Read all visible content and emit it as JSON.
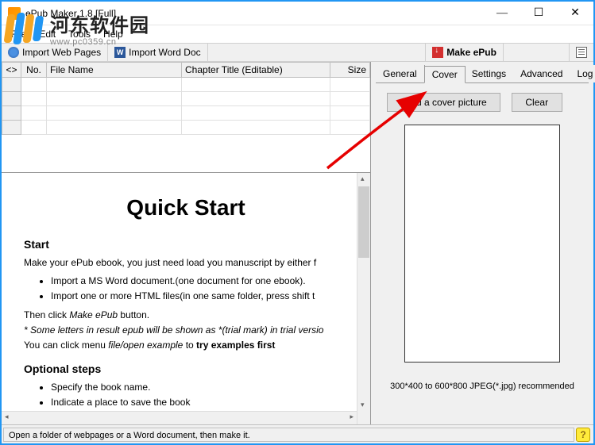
{
  "window": {
    "title": "ePub Maker 1.8 [Full]"
  },
  "menu": {
    "file": "File",
    "edit": "Edit",
    "tools": "Tools",
    "help": "Help"
  },
  "watermark": {
    "site_cn": "河东软件园",
    "site_url": "www.pc0359.cn"
  },
  "toolbar": {
    "import_web": "Import Web Pages",
    "import_word": "Import Word Doc",
    "make_epub": "Make ePub"
  },
  "table": {
    "headers": {
      "gutter": "<>",
      "no": "No.",
      "filename": "File Name",
      "chapter": "Chapter Title (Editable)",
      "size": "Size"
    }
  },
  "preview": {
    "title": "Quick Start",
    "h_start": "Start",
    "p1": "Make your ePub ebook, you just need load you manuscript by either f",
    "li1a": "Import a MS Word document.(one document for one ebook).",
    "li1b": "Import one or more HTML files(in one same folder, press shift t",
    "p2_a": "Then click ",
    "p2_em": "Make ePub",
    "p2_b": " button.",
    "p3_a": "* ",
    "p3_em": "Some letters in result epub will be shown as *(trial mark) in trial versio",
    "p4_a": "You can click menu ",
    "p4_em": "file/open example",
    "p4_b": " to ",
    "p4_strong": "try examples first",
    "h_optional": "Optional steps",
    "li2a": "Specify the book name.",
    "li2b": "Indicate a place to save the book"
  },
  "tabs": {
    "general": "General",
    "cover": "Cover",
    "settings": "Settings",
    "advanced": "Advanced",
    "log": "Log"
  },
  "cover": {
    "load_btn": "Load a cover picture",
    "clear_btn": "Clear",
    "hint": "300*400 to 600*800 JPEG(*.jpg) recommended"
  },
  "status": {
    "text": "Open a folder of webpages or a Word document, then make it."
  }
}
